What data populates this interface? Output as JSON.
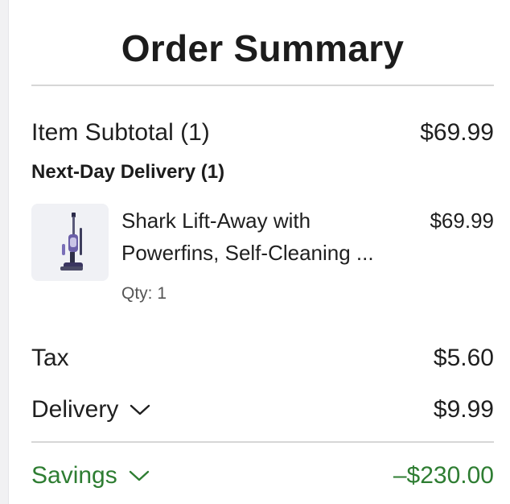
{
  "order_summary": {
    "title": "Order Summary",
    "item_subtotal": {
      "label": "Item Subtotal (1)",
      "value": "$69.99"
    },
    "delivery_group": {
      "heading": "Next-Day Delivery (1)",
      "items": [
        {
          "name_line1": "Shark Lift-Away with",
          "name_line2": "Powerfins, Self-Cleaning ...",
          "price": "$69.99",
          "qty": "Qty: 1",
          "image_icon": "vacuum-cleaner-icon"
        }
      ]
    },
    "tax": {
      "label": "Tax",
      "value": "$5.60"
    },
    "delivery": {
      "label": "Delivery",
      "value": "$9.99",
      "icon": "chevron-down-icon"
    },
    "savings": {
      "label": "Savings",
      "value": "–$230.00",
      "icon": "chevron-down-icon",
      "color": "#2e7d32"
    }
  }
}
